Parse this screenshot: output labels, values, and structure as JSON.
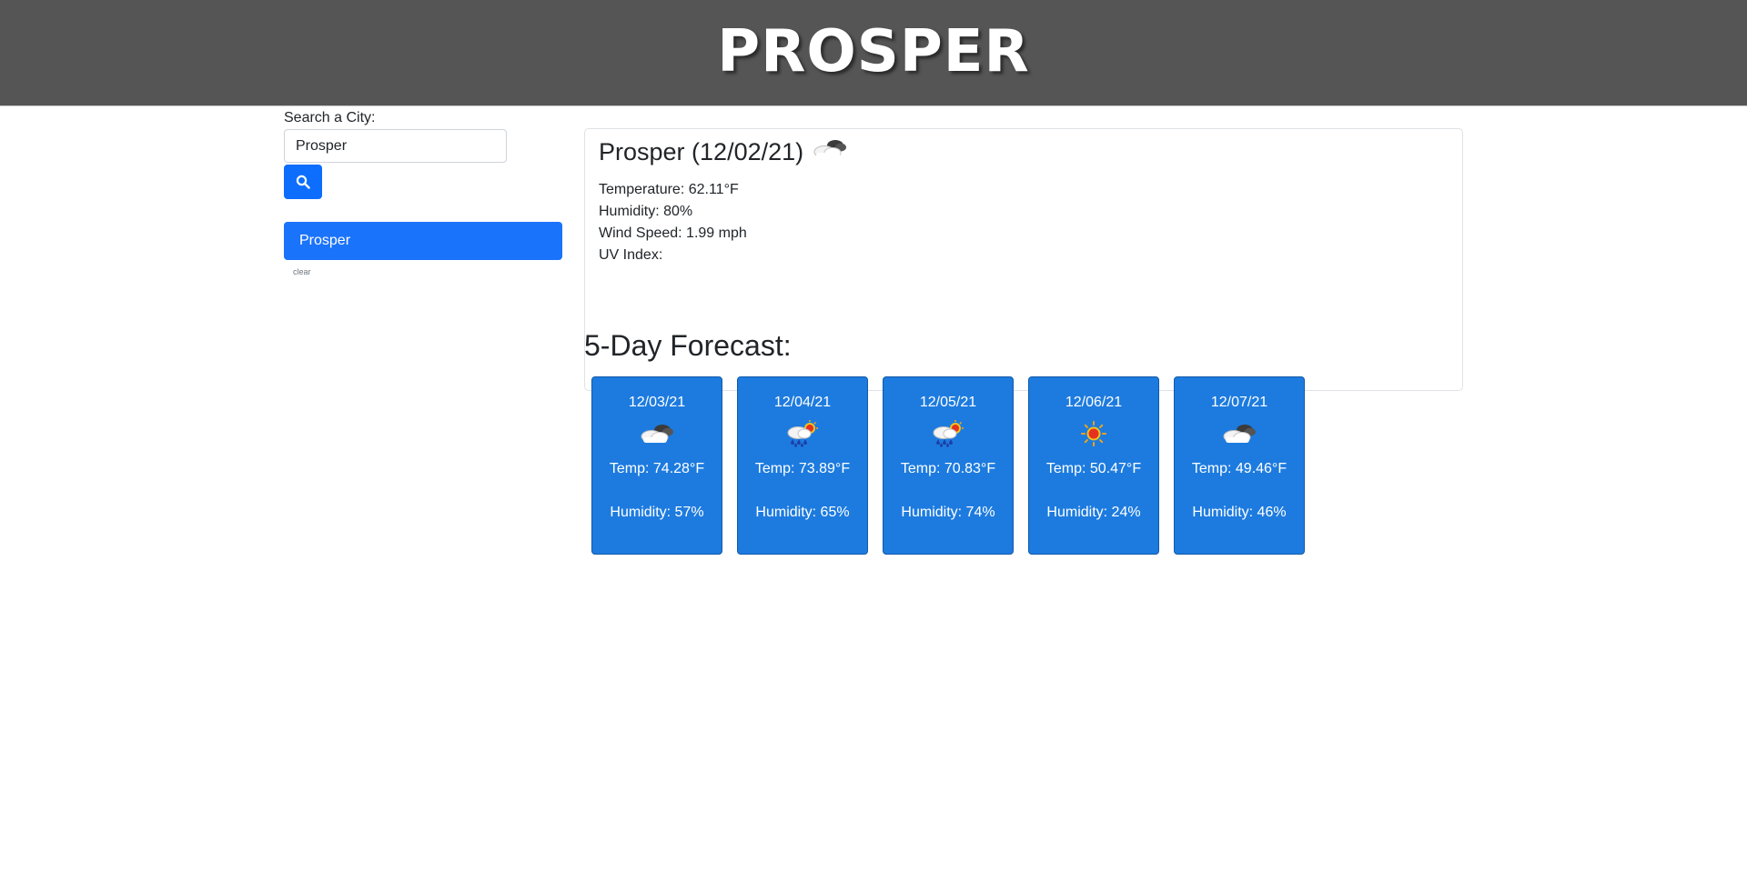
{
  "header": {
    "title": "PROSPER"
  },
  "sidebar": {
    "search_label": "Search a City:",
    "search_value": "Prosper",
    "search_icon": "search-icon",
    "history": [
      {
        "label": "Prosper"
      }
    ],
    "clear_label": "clear"
  },
  "current": {
    "title": "Prosper (12/02/21)",
    "icon": "cloudy-icon",
    "temperature": "Temperature: 62.11°F",
    "humidity": "Humidity: 80%",
    "wind": "Wind Speed: 1.99 mph",
    "uv": "UV Index:"
  },
  "forecast": {
    "title": "5-Day Forecast:",
    "days": [
      {
        "date": "12/03/21",
        "icon": "cloudy-icon",
        "temp": "Temp: 74.28°F",
        "humidity": "Humidity: 57%"
      },
      {
        "date": "12/04/21",
        "icon": "rain-sun-icon",
        "temp": "Temp: 73.89°F",
        "humidity": "Humidity: 65%"
      },
      {
        "date": "12/05/21",
        "icon": "rain-sun-icon",
        "temp": "Temp: 70.83°F",
        "humidity": "Humidity: 74%"
      },
      {
        "date": "12/06/21",
        "icon": "sun-icon",
        "temp": "Temp: 50.47°F",
        "humidity": "Humidity: 24%"
      },
      {
        "date": "12/07/21",
        "icon": "cloudy-icon",
        "temp": "Temp: 49.46°F",
        "humidity": "Humidity: 46%"
      }
    ]
  },
  "colors": {
    "header_bg": "#555555",
    "primary": "#0d6efd",
    "forecast_card": "#1d7bdf"
  }
}
